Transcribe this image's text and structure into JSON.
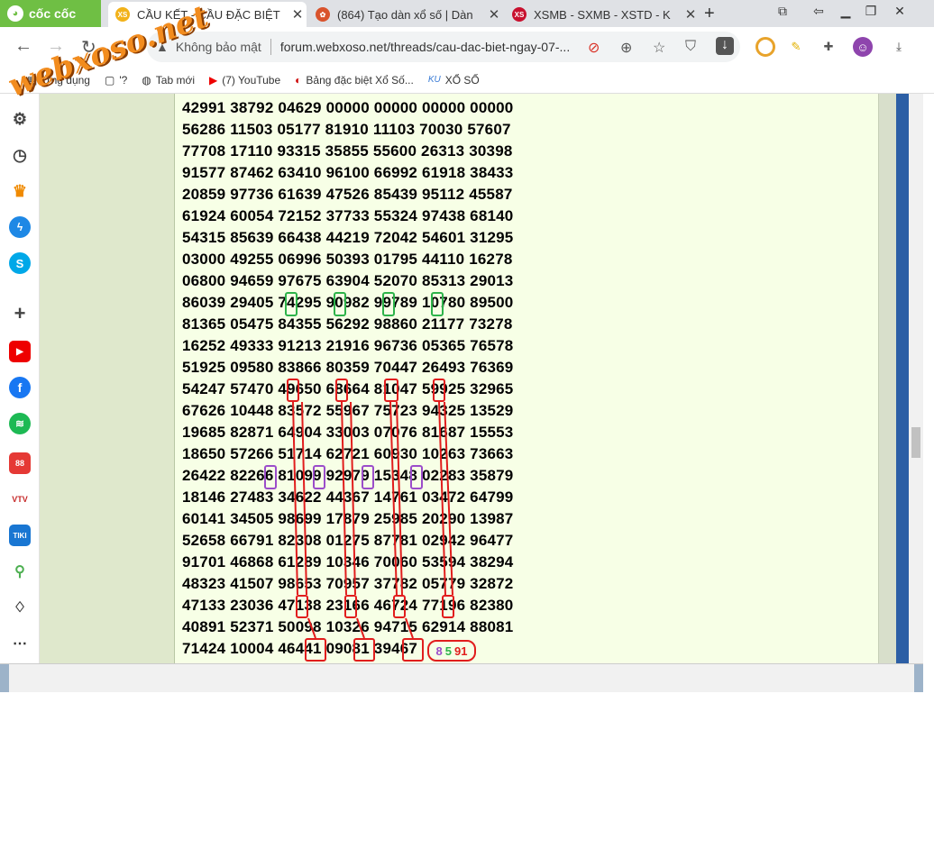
{
  "browser": {
    "brand": "cốc cốc",
    "tabs": [
      {
        "title": "CẦU KẾT - CẦU ĐẶC BIỆT",
        "close": "✕",
        "active": true,
        "fav": "XS",
        "fav_color": "#f2b21a"
      },
      {
        "title": "(864) Tạo dàn xổ số | Dàn",
        "close": "✕",
        "active": false,
        "fav": "",
        "fav_color": "#d9532c"
      },
      {
        "title": "XSMB - SXMB - XSTD - K",
        "close": "✕",
        "active": false,
        "fav": "XS",
        "fav_color": "#c8102e"
      }
    ],
    "new_tab": "+"
  },
  "toolbar": {
    "security_label": "Không bảo mật",
    "url": "forum.webxoso.net/threads/cau-dac-biet-ngay-07-..."
  },
  "bookmarks": [
    {
      "icon": "▦",
      "label": "Ứng dụng"
    },
    {
      "icon": "▢",
      "label": "'?"
    },
    {
      "icon": "◍",
      "label": "Tab mới"
    },
    {
      "icon": "▶",
      "label": "(7) YouTube"
    },
    {
      "icon": "◐",
      "label": "Bảng đặc biệt Xổ Số..."
    },
    {
      "icon": "KU",
      "label": "XỔ SỐ"
    }
  ],
  "watermark": "webxoso.net",
  "post": {
    "rows": [
      "42991 38792 04629 00000 00000 00000 00000",
      "56286 11503 05177 81910 11103 70030 57607",
      "77708 17110 93315 35855 55600 26313 30398",
      "91577 87462 63410 96100 66992 61918 38433",
      "20859 97736 61639 47526 85439 95112 45587",
      "61924 60054 72152 37733 55324 97438 68140",
      "54315 85639 66438 44219 72042 54601 31295",
      "03000 49255 06996 50393 01795 44110 16278",
      "06800 94659 97675 63904 52070 85313 29013",
      "86039 29405 74295 90982 99789 10780 89500",
      "81365 05475 84355 56292 98860 21177 73278",
      "16252 49333 91213 21916 96736 05365 76578",
      "51925 09580 83866 80359 70447 26493 76369",
      "54247 57470 49650 68664 81047 59925 32965",
      "67626 10448 83572 55967 75723 94325 13529",
      "19685 82871 64904 33003 07076 81687 15553",
      "18650 57266 51714 62721 60930 10263 73663",
      "26422 82266 81099 92979 15348 02283 35879",
      "18146 27483 34622 44367 14761 03472 64799",
      "60141 34505 98699 17879 25985 20290 13987",
      "52658 66791 82308 01275 87781 02942 96477",
      "91701 46868 61289 10346 70060 53594 38294",
      "48323 41507 98653 70957 37782 05779 32872",
      "47133 23036 47138 23166 46724 77196 82380",
      "40891 52371 50098 10326 94715 62914 88081",
      "71424 10004 46441 09081 39467"
    ],
    "result": {
      "a": "8",
      "b": "5",
      "c": "91"
    }
  }
}
